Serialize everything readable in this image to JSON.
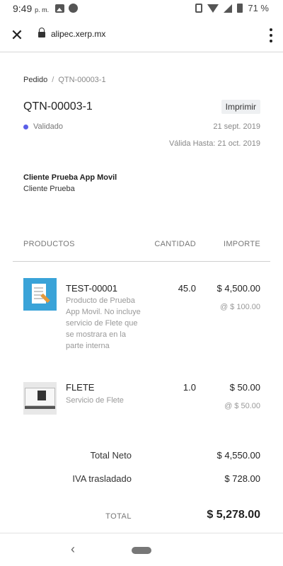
{
  "status_bar": {
    "time": "9:49",
    "ampm": "p. m.",
    "battery": "71 %",
    "icons": [
      "image-icon",
      "phone-icon",
      "vibrate-icon",
      "wifi-icon",
      "signal-icon",
      "battery-icon"
    ]
  },
  "browser": {
    "url": "alipec.xerp.mx",
    "close_icon": "close-icon",
    "menu_icon": "more-vert-icon"
  },
  "breadcrumb": {
    "parent": "Pedido",
    "separator": "/",
    "current": "QTN-00003-1"
  },
  "order": {
    "title": "QTN-00003-1",
    "print_label": "Imprimir",
    "status": "Validado",
    "status_color": "#5b5fe8",
    "date": "21 sept. 2019",
    "valid_until": "Válida Hasta: 21 oct. 2019"
  },
  "client": {
    "name": "Cliente Prueba App Movil",
    "subtitle": "Cliente Prueba"
  },
  "table": {
    "headers": {
      "products": "PRODUCTOS",
      "quantity": "CANTIDAD",
      "amount": "IMPORTE"
    },
    "items": [
      {
        "code": "TEST-00001",
        "description": "Producto de Prueba App Movil. No incluye servicio de Flete que se mostrara en la parte interna",
        "quantity": "45.0",
        "amount": "$ 4,500.00",
        "unit_price": "@ $ 100.00",
        "thumbnail": "document-signing-image"
      },
      {
        "code": "FLETE",
        "description": "Servicio de Flete",
        "quantity": "1.0",
        "amount": "$ 50.00",
        "unit_price": "@ $ 50.00",
        "thumbnail": "truck-image"
      }
    ]
  },
  "totals": {
    "net_label": "Total Neto",
    "net_value": "$ 4,550.00",
    "tax_label": "IVA trasladado",
    "tax_value": "$ 728.00",
    "total_label": "TOTAL",
    "total_value": "$ 5,278.00"
  },
  "nav": {
    "back_icon": "back-chevron-icon",
    "home_icon": "home-pill-icon"
  }
}
